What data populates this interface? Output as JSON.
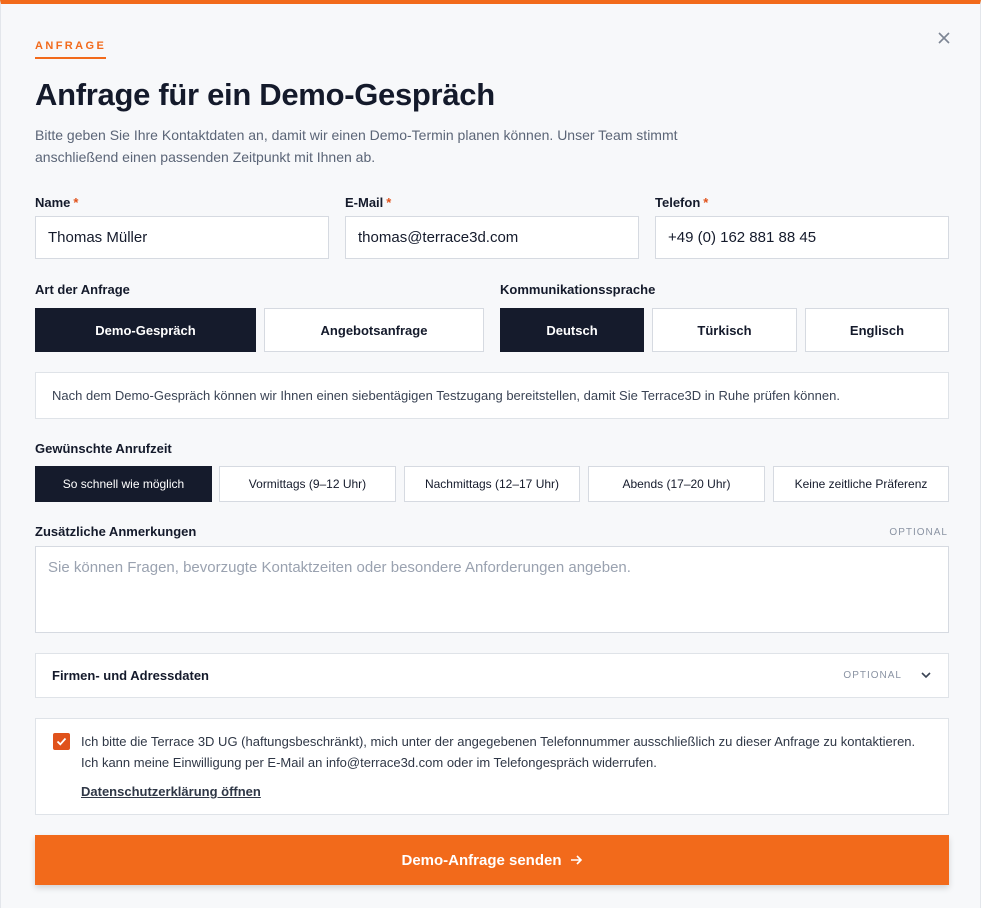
{
  "header": {
    "eyebrow": "ANFRAGE",
    "title": "Anfrage für ein Demo-Gespräch",
    "lead": "Bitte geben Sie Ihre Kontaktdaten an, damit wir einen Demo-Termin planen können. Unser Team stimmt anschließend einen passenden Zeitpunkt mit Ihnen ab."
  },
  "fields": {
    "name": {
      "label": "Name",
      "required_mark": "*",
      "value": "Thomas Müller"
    },
    "email": {
      "label": "E-Mail",
      "required_mark": "*",
      "value": "thomas@terrace3d.com"
    },
    "phone": {
      "label": "Telefon",
      "required_mark": "*",
      "value": "+49 (0) 162 881 88 45"
    }
  },
  "request_type": {
    "label": "Art der Anfrage",
    "options": [
      "Demo-Gespräch",
      "Angebotsanfrage"
    ],
    "selected": "Demo-Gespräch"
  },
  "language": {
    "label": "Kommunikationssprache",
    "options": [
      "Deutsch",
      "Türkisch",
      "Englisch"
    ],
    "selected": "Deutsch"
  },
  "info_note": "Nach dem Demo-Gespräch können wir Ihnen einen siebentägigen Testzugang bereitstellen, damit Sie Terrace3D in Ruhe prüfen können.",
  "call_time": {
    "label": "Gewünschte Anrufzeit",
    "options": [
      "So schnell wie möglich",
      "Vormittags (9–12 Uhr)",
      "Nachmittags (12–17 Uhr)",
      "Abends (17–20 Uhr)",
      "Keine zeitliche Präferenz"
    ],
    "selected": "So schnell wie möglich"
  },
  "notes": {
    "label": "Zusätzliche Anmerkungen",
    "optional": "OPTIONAL",
    "placeholder": "Sie können Fragen, bevorzugte Kontaktzeiten oder besondere Anforderungen angeben."
  },
  "company_section": {
    "title": "Firmen- und Adressdaten",
    "optional": "OPTIONAL"
  },
  "consent": {
    "checked": true,
    "text": "Ich bitte die Terrace 3D UG (haftungsbeschränkt), mich unter der angegebenen Telefonnummer ausschließlich zu dieser Anfrage zu kontaktieren. Ich kann meine Einwilligung per E-Mail an info@terrace3d.com oder im Telefongespräch widerrufen.",
    "link": "Datenschutzerklärung öffnen"
  },
  "submit": {
    "label": "Demo-Anfrage senden"
  },
  "colors": {
    "accent": "#f26a1b",
    "dark": "#151b2c"
  },
  "icons": {
    "close": "close-icon",
    "chevron": "chevron-down-icon",
    "arrow": "arrow-right-icon",
    "check": "check-icon"
  }
}
